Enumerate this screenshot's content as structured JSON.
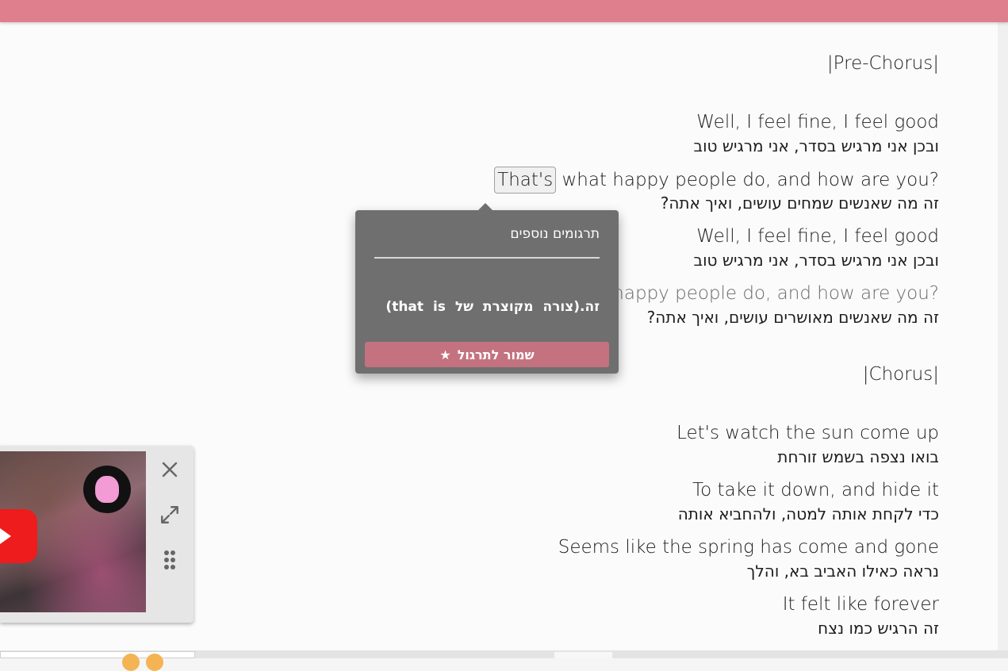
{
  "colors": {
    "top_bar": "#df7f8d",
    "popup_bg": "#6f6f6f",
    "save_button": "#c4727f",
    "play_button": "#ee1c1c"
  },
  "lyrics": {
    "pre_chorus_label": "|Pre-Chorus|",
    "l1_en": "Well, I feel fine, I feel good",
    "l1_he": "ובכן אני מרגיש בסדר, אני מרגיש טוב",
    "l2_word": "That's",
    "l2_rest": " what happy people do, and how are you?",
    "l2_he": "זה מה שאנשים שמחים עושים, ואיך אתה?",
    "l3_en": "Well, I feel fine, I feel good",
    "l3_he": "ובכן אני מרגיש בסדר, אני מרגיש טוב",
    "l4_en": "That's what happy people do, and how are you?",
    "l4_he": "זה מה שאנשים מאושרים עושים, ואיך אתה?",
    "chorus_label": "|Chorus|",
    "c1_en": "Let's watch the sun come up",
    "c1_he": "בואו נצפה בשמש זורחת",
    "c2_en": "To take it down, and hide it",
    "c2_he": "כדי לקחת אותה למטה, ולהחביא אותה",
    "c3_en": "Seems like the spring has come and gone",
    "c3_he": "נראה כאילו האביב בא, והלך",
    "c4_en": "It felt like forever",
    "c4_he": "זה הרגיש כמו נצח"
  },
  "popup": {
    "title": "תרגומים נוספים",
    "translation": "זה.(צורה מקוצרת של that is)",
    "save_label": "שמור לתרגול",
    "save_icon": "star-icon"
  },
  "player": {
    "close_icon": "close-icon",
    "expand_icon": "expand-icon",
    "drag_icon": "drag-handle-icon",
    "play_icon": "youtube-play-icon"
  }
}
